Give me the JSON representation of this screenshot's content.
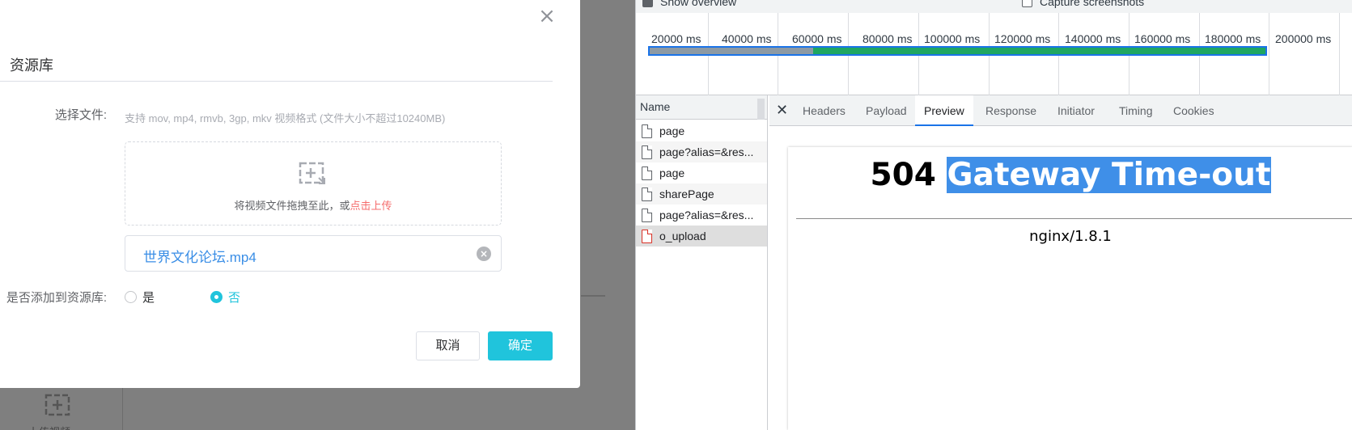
{
  "modal": {
    "title": "资源库",
    "close_icon": "close-icon",
    "file_label": "选择文件:",
    "file_hint": "支持 mov, mp4, rmvb, 3gp, mkv 视频格式 (文件大小不超过10240MB)",
    "drop_text": "将视频文件拖拽至此，或",
    "drop_link": "点击上传",
    "file_name": "世界文化论坛.mp4",
    "add_label": "是否添加到资源库:",
    "radio_yes": "是",
    "radio_no": "否",
    "selected_radio": "否",
    "cancel_label": "取消",
    "ok_label": "确定"
  },
  "background": {
    "upload_text": "上传视频"
  },
  "devtools": {
    "show_overview_label": "Show overview",
    "capture_screenshots_label": "Capture screenshots",
    "timeline_ticks": [
      "20000 ms",
      "40000 ms",
      "60000 ms",
      "80000 ms",
      "100000 ms",
      "120000 ms",
      "140000 ms",
      "160000 ms",
      "180000 ms",
      "200000 ms"
    ],
    "name_header": "Name",
    "requests": [
      {
        "name": "page",
        "status": "ok"
      },
      {
        "name": "page?alias=&res...",
        "status": "ok"
      },
      {
        "name": "page",
        "status": "ok"
      },
      {
        "name": "sharePage",
        "status": "ok"
      },
      {
        "name": "page?alias=&res...",
        "status": "ok"
      },
      {
        "name": "o_upload",
        "status": "error"
      }
    ],
    "tabs": [
      "Headers",
      "Payload",
      "Preview",
      "Response",
      "Initiator",
      "Timing",
      "Cookies"
    ],
    "active_tab": "Preview",
    "preview": {
      "code": "504",
      "message": "Gateway Time-out",
      "server": "nginx/1.8.1"
    },
    "colors": {
      "accent": "#1a73e8",
      "error": "#d93025",
      "primary_button": "#20c4dc"
    }
  }
}
